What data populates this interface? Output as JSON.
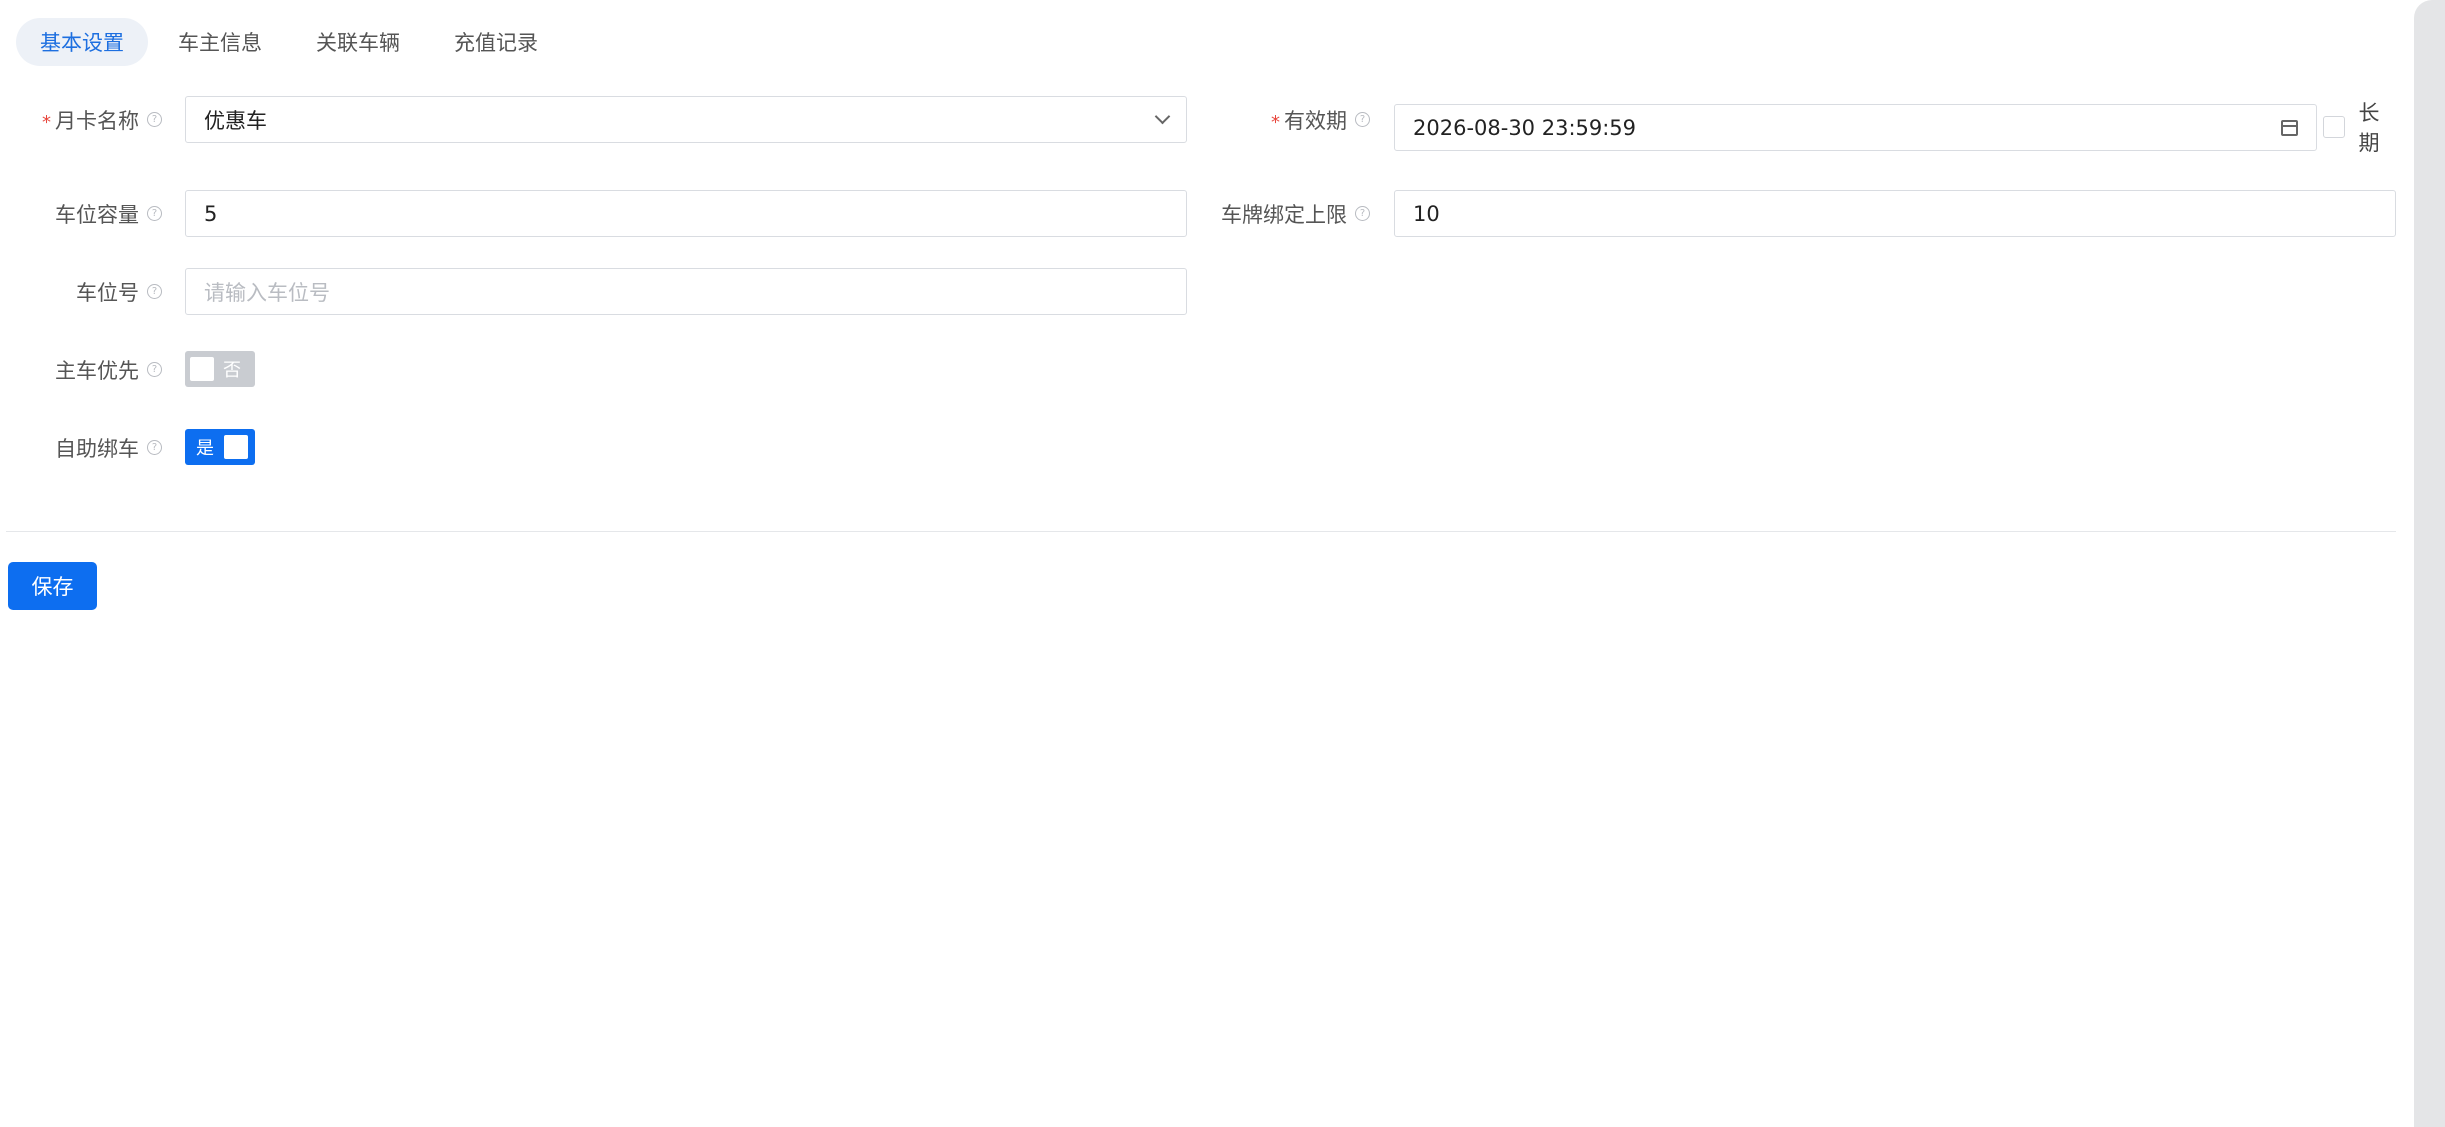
{
  "tabs": [
    {
      "label": "基本设置",
      "active": true
    },
    {
      "label": "车主信息",
      "active": false
    },
    {
      "label": "关联车辆",
      "active": false
    },
    {
      "label": "充值记录",
      "active": false
    }
  ],
  "form": {
    "card_name": {
      "label": "月卡名称",
      "required": true,
      "value": "优惠车"
    },
    "validity": {
      "label": "有效期",
      "required": true,
      "value": "2026-08-30 23:59:59",
      "long_term_label": "长期",
      "long_term_checked": false
    },
    "spot_capacity": {
      "label": "车位容量",
      "value": "5"
    },
    "plate_limit": {
      "label": "车牌绑定上限",
      "value": "10"
    },
    "spot_number": {
      "label": "车位号",
      "placeholder": "请输入车位号"
    },
    "main_car_priority": {
      "label": "主车优先",
      "state_text": "否",
      "on": false
    },
    "self_bind": {
      "label": "自助绑车",
      "state_text": "是",
      "on": true
    }
  },
  "actions": {
    "save_label": "保存"
  },
  "colors": {
    "primary": "#0d6ef0",
    "required": "#e8453c",
    "switch_off": "#c9ccd1"
  },
  "icons": {
    "help": "question-circle-icon",
    "select": "chevron-down-icon",
    "date": "calendar-icon"
  }
}
